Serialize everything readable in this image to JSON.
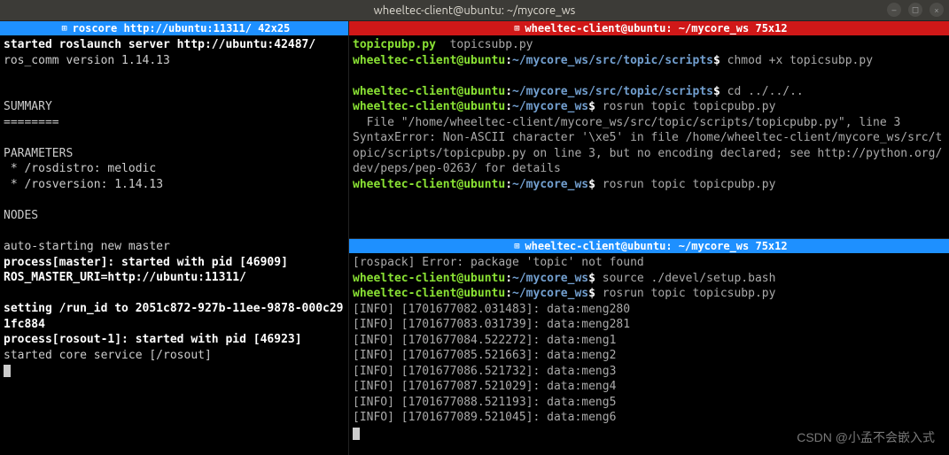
{
  "window": {
    "title": "wheeltec-client@ubuntu: ~/mycore_ws"
  },
  "panes": {
    "left": {
      "title": "roscore http://ubuntu:11311/ 42x25",
      "lines": [
        {
          "t": "bold",
          "v": "started roslaunch server http://ubuntu:42487/"
        },
        {
          "t": "plain",
          "v": "ros_comm version 1.14.13"
        },
        {
          "t": "blank"
        },
        {
          "t": "blank"
        },
        {
          "t": "plain",
          "v": "SUMMARY"
        },
        {
          "t": "plain",
          "v": "========"
        },
        {
          "t": "blank"
        },
        {
          "t": "plain",
          "v": "PARAMETERS"
        },
        {
          "t": "plain",
          "v": " * /rosdistro: melodic"
        },
        {
          "t": "plain",
          "v": " * /rosversion: 1.14.13"
        },
        {
          "t": "blank"
        },
        {
          "t": "plain",
          "v": "NODES"
        },
        {
          "t": "blank"
        },
        {
          "t": "plain",
          "v": "auto-starting new master"
        },
        {
          "t": "bold",
          "v": "process[master]: started with pid [46909]"
        },
        {
          "t": "bold",
          "v": "ROS_MASTER_URI=http://ubuntu:11311/"
        },
        {
          "t": "blank"
        },
        {
          "t": "bold",
          "v": "setting /run_id to 2051c872-927b-11ee-9878-000c291fc884"
        },
        {
          "t": "bold",
          "v": "process[rosout-1]: started with pid [46923]"
        },
        {
          "t": "plain",
          "v": "started core service [/rosout]"
        },
        {
          "t": "cursor"
        }
      ]
    },
    "rightTop": {
      "title": "wheeltec-client@ubuntu: ~/mycore_ws 75x12",
      "content": [
        {
          "seg": [
            {
              "c": "ps1-user",
              "v": "topicpubp.py"
            },
            {
              "c": "dim",
              "v": "  topicsubp.py"
            }
          ]
        },
        {
          "seg": [
            {
              "c": "ps1-user",
              "v": "wheeltec-client@ubuntu"
            },
            {
              "c": "ps1-white",
              "v": ":"
            },
            {
              "c": "ps1-path",
              "v": "~/mycore_ws/src/topic/scripts"
            },
            {
              "c": "ps1-white",
              "v": "$ "
            },
            {
              "c": "dim",
              "v": "chmod +x topicsubp.py"
            }
          ]
        },
        {
          "seg": []
        },
        {
          "seg": [
            {
              "c": "ps1-user",
              "v": "wheeltec-client@ubuntu"
            },
            {
              "c": "ps1-white",
              "v": ":"
            },
            {
              "c": "ps1-path",
              "v": "~/mycore_ws/src/topic/scripts"
            },
            {
              "c": "ps1-white",
              "v": "$ "
            },
            {
              "c": "dim",
              "v": "cd ../../.."
            }
          ]
        },
        {
          "seg": [
            {
              "c": "ps1-user",
              "v": "wheeltec-client@ubuntu"
            },
            {
              "c": "ps1-white",
              "v": ":"
            },
            {
              "c": "ps1-path",
              "v": "~/mycore_ws"
            },
            {
              "c": "ps1-white",
              "v": "$ "
            },
            {
              "c": "dim",
              "v": "rosrun topic topicpubp.py"
            }
          ]
        },
        {
          "seg": [
            {
              "c": "dim",
              "v": "  File \"/home/wheeltec-client/mycore_ws/src/topic/scripts/topicpubp.py\", line 3"
            }
          ]
        },
        {
          "seg": [
            {
              "c": "dim",
              "v": "SyntaxError: Non-ASCII character '\\xe5' in file /home/wheeltec-client/mycore_ws/src/topic/scripts/topicpubp.py on line 3, but no encoding declared; see http://python.org/dev/peps/pep-0263/ for details"
            }
          ]
        },
        {
          "seg": [
            {
              "c": "ps1-user",
              "v": "wheeltec-client@ubuntu"
            },
            {
              "c": "ps1-white",
              "v": ":"
            },
            {
              "c": "ps1-path",
              "v": "~/mycore_ws"
            },
            {
              "c": "ps1-white",
              "v": "$ "
            },
            {
              "c": "dim",
              "v": "rosrun topic topicpubp.py"
            }
          ]
        }
      ]
    },
    "rightBot": {
      "title": "wheeltec-client@ubuntu: ~/mycore_ws 75x12",
      "content": [
        {
          "seg": [
            {
              "c": "dim",
              "v": "[rospack] Error: package 'topic' not found"
            }
          ]
        },
        {
          "seg": [
            {
              "c": "ps1-user",
              "v": "wheeltec-client@ubuntu"
            },
            {
              "c": "ps1-white",
              "v": ":"
            },
            {
              "c": "ps1-path",
              "v": "~/mycore_ws"
            },
            {
              "c": "ps1-white",
              "v": "$ "
            },
            {
              "c": "dim",
              "v": "source ./devel/setup.bash"
            }
          ]
        },
        {
          "seg": [
            {
              "c": "ps1-user",
              "v": "wheeltec-client@ubuntu"
            },
            {
              "c": "ps1-white",
              "v": ":"
            },
            {
              "c": "ps1-path",
              "v": "~/mycore_ws"
            },
            {
              "c": "ps1-white",
              "v": "$ "
            },
            {
              "c": "dim",
              "v": "rosrun topic topicsubp.py"
            }
          ]
        },
        {
          "seg": [
            {
              "c": "dim",
              "v": "[INFO] [1701677082.031483]: data:meng280"
            }
          ]
        },
        {
          "seg": [
            {
              "c": "dim",
              "v": "[INFO] [1701677083.031739]: data:meng281"
            }
          ]
        },
        {
          "seg": [
            {
              "c": "dim",
              "v": "[INFO] [1701677084.522272]: data:meng1"
            }
          ]
        },
        {
          "seg": [
            {
              "c": "dim",
              "v": "[INFO] [1701677085.521663]: data:meng2"
            }
          ]
        },
        {
          "seg": [
            {
              "c": "dim",
              "v": "[INFO] [1701677086.521732]: data:meng3"
            }
          ]
        },
        {
          "seg": [
            {
              "c": "dim",
              "v": "[INFO] [1701677087.521029]: data:meng4"
            }
          ]
        },
        {
          "seg": [
            {
              "c": "dim",
              "v": "[INFO] [1701677088.521193]: data:meng5"
            }
          ]
        },
        {
          "seg": [
            {
              "c": "dim",
              "v": "[INFO] [1701677089.521045]: data:meng6"
            }
          ]
        },
        {
          "seg": [
            {
              "c": "cursor",
              "v": ""
            }
          ]
        }
      ]
    }
  },
  "watermark": "CSDN @小孟不会嵌入式"
}
